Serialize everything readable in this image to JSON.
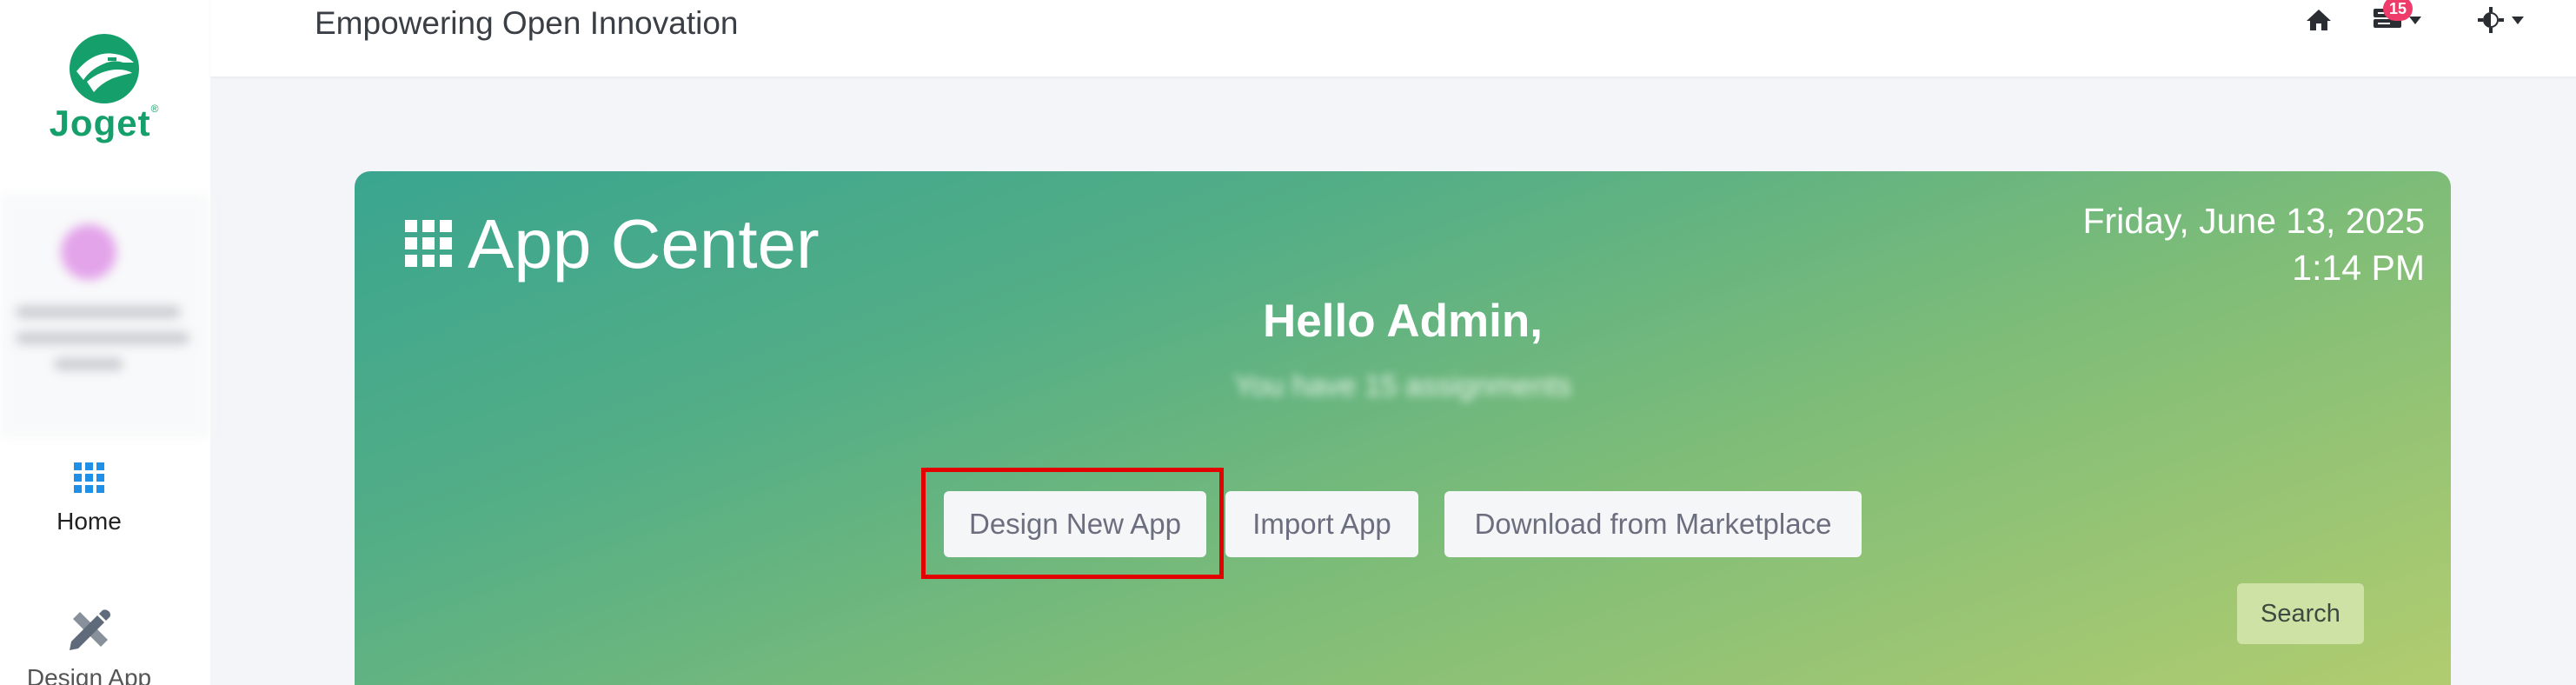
{
  "brand": {
    "name": "Joget",
    "trademark": "®",
    "color": "#15a06b"
  },
  "topbar": {
    "tagline": "Empowering Open Innovation",
    "icons": [
      "home-icon",
      "inbox-icon",
      "theme-icon"
    ],
    "inbox_badge": "15",
    "badge_color": "#ee3b6a"
  },
  "sidebar": {
    "items": [
      {
        "label": "Home",
        "icon": "grid-icon",
        "color": "#1e90e8"
      },
      {
        "label": "Design App",
        "icon": "pencil-ruler-icon",
        "color": "#6b7280"
      }
    ]
  },
  "hero": {
    "title": "App Center",
    "date": "Friday, June 13, 2025",
    "time": "1:14 PM",
    "greeting": "Hello Admin,",
    "subtext": "You have 15 assignments",
    "buttons": {
      "design_new_app": "Design New App",
      "import_app": "Import App",
      "download_marketplace": "Download from Marketplace",
      "search": "Search"
    },
    "gradient": [
      "#3aa58f",
      "#b4cd6f"
    ],
    "highlight_color": "#e20000"
  }
}
